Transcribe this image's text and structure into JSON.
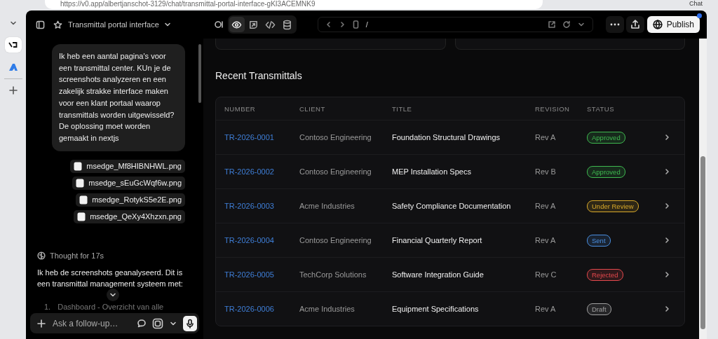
{
  "browser": {
    "url": "https://v0.app/albertjanschot-3129/chat/transmittal-portal-interface-gKI3ACEMNK9",
    "profile_label": "Chat"
  },
  "topbar": {
    "project_title": "Transmittal portal interface",
    "view_modes": [
      {
        "kind": "preview",
        "selected": true
      },
      {
        "kind": "deploy",
        "selected": false
      },
      {
        "kind": "code",
        "selected": false
      },
      {
        "kind": "database",
        "selected": false
      }
    ],
    "path": "/",
    "publish_label": "Publish",
    "publish_notification": true
  },
  "chat": {
    "user_message": "Ik heb een aantal pagina's voor een transmittal center. KUn je de screenshots analyzeren en een zakelijk strakke interface maken voor een klant portaal waarop transmittals worden uitgewisseld? De oplossing moet worden gemaakt in nextjs",
    "attachments": [
      "msedge_Mf8HIBNHWL.png",
      "msedge_sEuGcWqf6w.png",
      "msedge_RotykS5e2E.png",
      "msedge_QeXy4Xhzxn.png"
    ],
    "thought": "Thought for 17s",
    "reply": "Ik heb de screenshots geanalyseerd. Dit is een transmittal management systeem met:",
    "reply_list": [
      {
        "number": "1.",
        "text": "Dashboard - Overzicht van alle"
      }
    ],
    "input": {
      "placeholder": "Ask a follow-up…"
    }
  },
  "preview": {
    "heading": "Recent Transmittals",
    "table": {
      "columns": [
        "NUMBER",
        "CLIENT",
        "TITLE",
        "REVISION",
        "STATUS"
      ],
      "rows": [
        {
          "number": "TR-2026-0001",
          "client": "Contoso Engineering",
          "title": "Foundation Structural Drawings",
          "revision": "Rev A",
          "status": "Approved",
          "color": "#3fb950"
        },
        {
          "number": "TR-2026-0002",
          "client": "Contoso Engineering",
          "title": "MEP Installation Specs",
          "revision": "Rev B",
          "status": "Approved",
          "color": "#3fb950"
        },
        {
          "number": "TR-2026-0003",
          "client": "Acme Industries",
          "title": "Safety Compliance Documentation",
          "revision": "Rev A",
          "status": "Under Review",
          "color": "#d9a92a"
        },
        {
          "number": "TR-2026-0004",
          "client": "Contoso Engineering",
          "title": "Financial Quarterly Report",
          "revision": "Rev A",
          "status": "Sent",
          "color": "#4a8fe0"
        },
        {
          "number": "TR-2026-0005",
          "client": "TechCorp Solutions",
          "title": "Software Integration Guide",
          "revision": "Rev C",
          "status": "Rejected",
          "color": "#e5484d"
        },
        {
          "number": "TR-2026-0006",
          "client": "Acme Industries",
          "title": "Equipment Specifications",
          "revision": "Rev A",
          "status": "Draft",
          "color": "#a0a0a0"
        }
      ]
    }
  }
}
